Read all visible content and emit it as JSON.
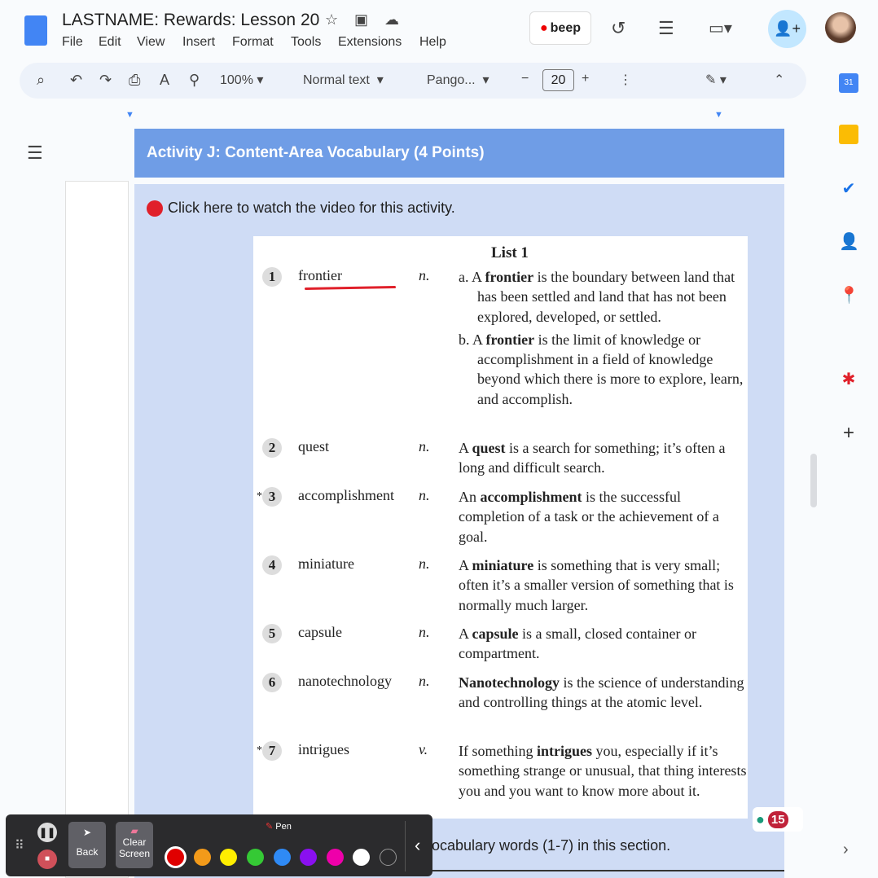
{
  "doc": {
    "title": "LASTNAME: Rewards: Lesson 20",
    "menus": [
      "File",
      "Edit",
      "View",
      "Insert",
      "Format",
      "Tools",
      "Extensions",
      "Help"
    ]
  },
  "toolbar": {
    "zoom": "100%",
    "style": "Normal text",
    "font": "Pango...",
    "size": "20"
  },
  "beep": "beep",
  "section": {
    "header": "Activity J: Content-Area Vocabulary (4 Points)",
    "video": "Click here to watch the video for this activity.",
    "bottom": "ocabulary words (1-7) in this section."
  },
  "list": {
    "title": "List 1",
    "items": [
      {
        "n": "1",
        "word": "frontier",
        "pos": "n.",
        "def": "a. A frontier is the boundary between land that has been settled and land that has not been explored, developed, or settled.<br>b. A frontier is the limit of knowledge or accomplishment in a field of knowledge beyond which there is more to explore, learn, and accomplish.",
        "star": false
      },
      {
        "n": "2",
        "word": "quest",
        "pos": "n.",
        "def": "A quest is a search for something; it’s often a long and difficult search.",
        "star": false
      },
      {
        "n": "3",
        "word": "accomplishment",
        "pos": "n.",
        "def": "An accomplishment is the successful completion of a task or the achievement of a goal.",
        "star": true
      },
      {
        "n": "4",
        "word": "miniature",
        "pos": "n.",
        "def": "A miniature is something that is very small; often it’s a smaller version of something that is normally much larger.",
        "star": false
      },
      {
        "n": "5",
        "word": "capsule",
        "pos": "n.",
        "def": "A capsule is a small, closed container or compartment.",
        "star": false
      },
      {
        "n": "6",
        "word": "nanotechnology",
        "pos": "n.",
        "def": "Nanotechnology is the science of understanding and controlling things at the atomic level.",
        "star": false
      },
      {
        "n": "7",
        "word": "intrigues",
        "pos": "v.",
        "def": "If something intrigues you, especially if it’s something strange or unusual, that thing interests you and you want to know more about it.",
        "star": true
      }
    ]
  },
  "recorder": {
    "pen": "Pen",
    "back": "Back",
    "clear": "Clear Screen",
    "colors": [
      "#e00000",
      "#f39a1a",
      "#ffee00",
      "#35c935",
      "#2f8af5",
      "#8a10f0",
      "#ee00aa",
      "#ffffff",
      "transparent"
    ]
  },
  "badge": "15"
}
